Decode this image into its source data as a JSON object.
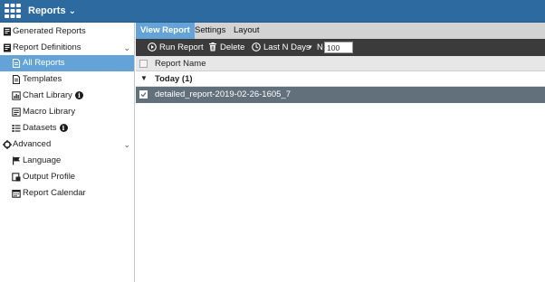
{
  "header": {
    "menu_label": "Reports",
    "menu_chevron": "chevron-down-icon",
    "logo": "fortinet-logo-icon"
  },
  "sidebar": {
    "items": [
      {
        "label": "Generated Reports",
        "icon": "report-icon"
      },
      {
        "label": "Report Definitions",
        "icon": "report-icon",
        "expanded": true
      },
      {
        "label": "All Reports",
        "icon": "document-icon",
        "active": true
      },
      {
        "label": "Templates",
        "icon": "document-icon"
      },
      {
        "label": "Chart Library",
        "icon": "chart-icon",
        "info": true
      },
      {
        "label": "Macro Library",
        "icon": "macro-icon"
      },
      {
        "label": "Datasets",
        "icon": "dataset-icon",
        "info": true
      },
      {
        "label": "Advanced",
        "icon": "gear-icon",
        "expanded": true
      },
      {
        "label": "Language",
        "icon": "flag-icon"
      },
      {
        "label": "Output Profile",
        "icon": "output-icon"
      },
      {
        "label": "Report Calendar",
        "icon": "calendar-icon"
      }
    ],
    "info_glyph": "i"
  },
  "tabs": [
    {
      "label": "View Report",
      "active": true
    },
    {
      "label": "Settings"
    },
    {
      "label": "Layout"
    }
  ],
  "toolbar": {
    "run_label": "Run Report",
    "delete_label": "Delete",
    "period_label": "Last N Days",
    "n_label": "N",
    "n_value": "100"
  },
  "grid": {
    "column_header": "Report Name",
    "group_label": "Today (1)",
    "rows": [
      {
        "name": "detailed_report-2019-02-26-1605_7",
        "selected": true
      }
    ]
  },
  "colors": {
    "topbar": "#2c6aa0",
    "active": "#63a3d8",
    "toolbar": "#3b3b3b",
    "selected_row": "#62707c"
  }
}
